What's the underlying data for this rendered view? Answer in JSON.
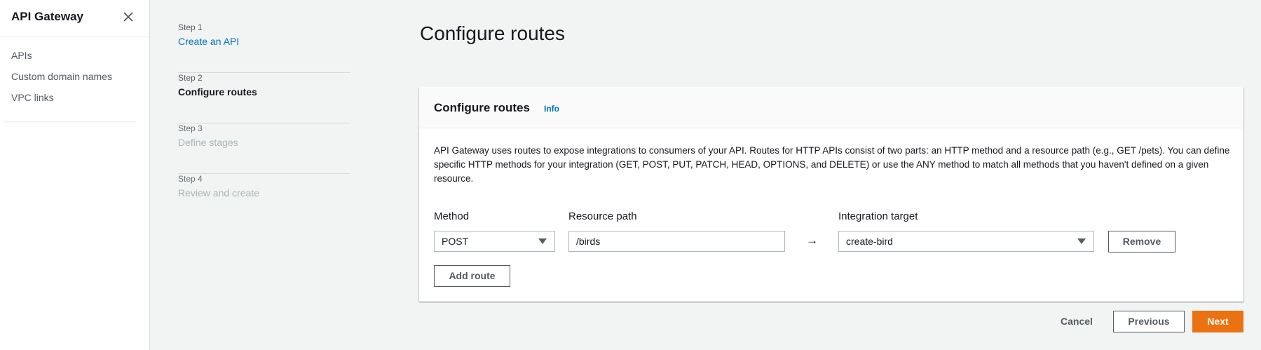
{
  "sidebar": {
    "title": "API Gateway",
    "items": [
      {
        "label": "APIs"
      },
      {
        "label": "Custom domain names"
      },
      {
        "label": "VPC links"
      }
    ]
  },
  "steps": [
    {
      "number": "Step 1",
      "label": "Create an API",
      "state": "done"
    },
    {
      "number": "Step 2",
      "label": "Configure routes",
      "state": "active"
    },
    {
      "number": "Step 3",
      "label": "Define stages",
      "state": "disabled"
    },
    {
      "number": "Step 4",
      "label": "Review and create",
      "state": "disabled"
    }
  ],
  "page": {
    "title": "Configure routes"
  },
  "panel": {
    "title": "Configure routes",
    "info_label": "Info",
    "description": "API Gateway uses routes to expose integrations to consumers of your API. Routes for HTTP APIs consist of two parts: an HTTP method and a resource path (e.g., GET /pets). You can define specific HTTP methods for your integration (GET, POST, PUT, PATCH, HEAD, OPTIONS, and DELETE) or use the ANY method to match all methods that you haven't defined on a given resource."
  },
  "route": {
    "method_label": "Method",
    "method_value": "POST",
    "resource_label": "Resource path",
    "resource_value": "/birds",
    "arrow": "→",
    "target_label": "Integration target",
    "target_value": "create-bird",
    "remove_label": "Remove"
  },
  "add_route_label": "Add route",
  "footer": {
    "cancel_label": "Cancel",
    "previous_label": "Previous",
    "next_label": "Next"
  },
  "colors": {
    "link": "#0073bb",
    "primary": "#ec7211",
    "background": "#f2f3f3"
  }
}
